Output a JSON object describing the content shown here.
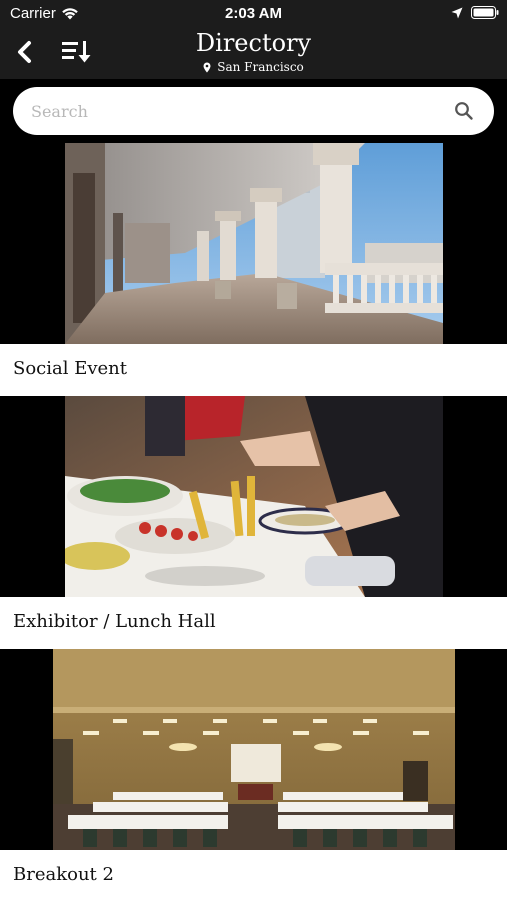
{
  "status_bar": {
    "carrier": "Carrier",
    "time": "2:03 AM"
  },
  "nav": {
    "title": "Directory",
    "location": "San Francisco"
  },
  "search": {
    "placeholder": "Search"
  },
  "rooms": [
    {
      "name": "Social Event"
    },
    {
      "name": "Exhibitor / Lunch Hall"
    },
    {
      "name": "Breakout 2"
    }
  ],
  "colors": {
    "bar_background": "#1c1c1c",
    "page_background": "#000000",
    "card_label_background": "#ffffff"
  }
}
